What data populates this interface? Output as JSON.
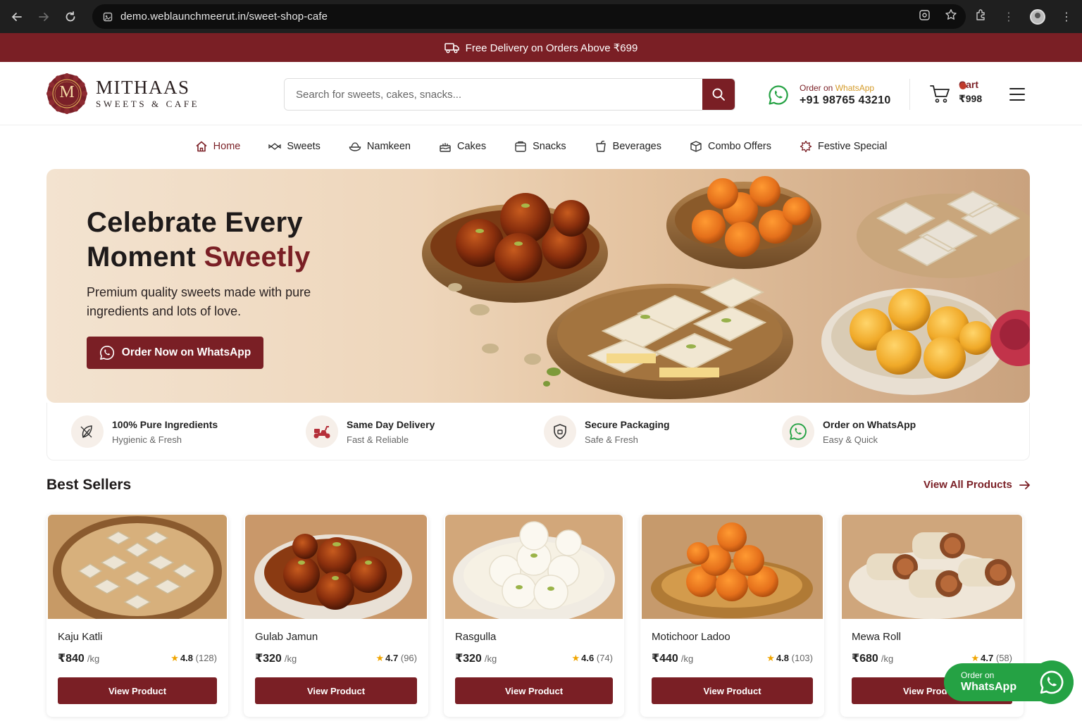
{
  "browser": {
    "url": "demo.weblaunchmeerut.in/sweet-shop-cafe"
  },
  "promo": {
    "text": "Free Delivery on Orders Above ₹699"
  },
  "brand": {
    "initial": "M",
    "name": "MITHAAS",
    "tagline": "SWEETS & CAFE"
  },
  "search": {
    "placeholder": "Search for sweets, cakes, snacks..."
  },
  "whatsapp_order": {
    "label_prefix": "Order on",
    "label_brand": "WhatsApp",
    "phone": "+91 98765 43210"
  },
  "cart": {
    "label": "Cart",
    "amount": "₹998"
  },
  "nav": {
    "items": [
      {
        "label": "Home",
        "icon": "home-icon"
      },
      {
        "label": "Sweets",
        "icon": "candy-icon"
      },
      {
        "label": "Namkeen",
        "icon": "bowl-icon"
      },
      {
        "label": "Cakes",
        "icon": "cake-icon"
      },
      {
        "label": "Snacks",
        "icon": "snack-box-icon"
      },
      {
        "label": "Beverages",
        "icon": "cup-icon"
      },
      {
        "label": "Combo Offers",
        "icon": "gift-box-icon"
      },
      {
        "label": "Festive Special",
        "icon": "festive-star-icon"
      }
    ]
  },
  "hero": {
    "title_line1": "Celebrate Every",
    "title_line2_plain": "Moment ",
    "title_line2_accent": "Sweetly",
    "subtitle": "Premium quality sweets made with pure ingredients and lots of love.",
    "cta": "Order Now on WhatsApp"
  },
  "features": [
    {
      "title": "100% Pure Ingredients",
      "subtitle": "Hygienic & Fresh",
      "icon": "leaf-icon"
    },
    {
      "title": "Same Day Delivery",
      "subtitle": "Fast & Reliable",
      "icon": "scooter-icon"
    },
    {
      "title": "Secure Packaging",
      "subtitle": "Safe & Fresh",
      "icon": "shield-icon"
    },
    {
      "title": "Order on WhatsApp",
      "subtitle": "Easy & Quick",
      "icon": "whatsapp-icon"
    }
  ],
  "best_sellers": {
    "title": "Best Sellers",
    "view_all": "View All Products",
    "products": [
      {
        "name": "Kaju Katli",
        "price": "₹840",
        "unit": "/kg",
        "rating": "4.8",
        "count": "(128)",
        "button": "View Product"
      },
      {
        "name": "Gulab Jamun",
        "price": "₹320",
        "unit": "/kg",
        "rating": "4.7",
        "count": "(96)",
        "button": "View Product"
      },
      {
        "name": "Rasgulla",
        "price": "₹320",
        "unit": "/kg",
        "rating": "4.6",
        "count": "(74)",
        "button": "View Product"
      },
      {
        "name": "Motichoor Ladoo",
        "price": "₹440",
        "unit": "/kg",
        "rating": "4.8",
        "count": "(103)",
        "button": "View Product"
      },
      {
        "name": "Mewa Roll",
        "price": "₹680",
        "unit": "/kg",
        "rating": "4.7",
        "count": "(58)",
        "button": "View Product"
      }
    ]
  },
  "floating_whatsapp": {
    "line1": "Order on",
    "line2": "WhatsApp"
  },
  "colors": {
    "brand": "#7a1f25",
    "whatsapp": "#25a244",
    "gold": "#d49b2a",
    "star": "#f0a500"
  }
}
